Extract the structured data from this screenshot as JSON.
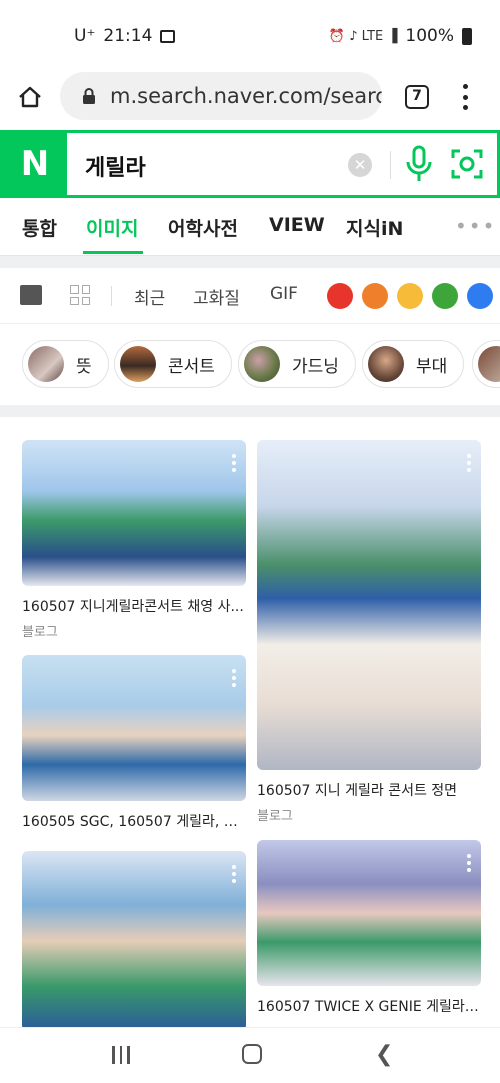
{
  "status_bar": {
    "carrier": "U⁺",
    "time": "21:14",
    "indicators": "⏰ ♪ LTE ▐",
    "battery": "100%"
  },
  "browser": {
    "url": "m.search.naver.com/search",
    "tab_count": "7"
  },
  "search": {
    "logo": "N",
    "query": "게릴라",
    "clear_icon": "✕"
  },
  "nav_tabs": [
    {
      "label": "통합"
    },
    {
      "label": "이미지"
    },
    {
      "label": "어학사전"
    },
    {
      "label": "VIEW"
    },
    {
      "label": "지식iN"
    }
  ],
  "nav_more": "•••",
  "filters": {
    "options": [
      "최근",
      "고화질",
      "GIF"
    ],
    "colors": [
      "#e8352b",
      "#f07f2c",
      "#f7bb3a",
      "#3da53a",
      "#2f7cf0"
    ]
  },
  "chips": [
    {
      "label": "뜻"
    },
    {
      "label": "콘서트"
    },
    {
      "label": "가드닝"
    },
    {
      "label": "부대"
    }
  ],
  "results": [
    {
      "title": "160507 지니게릴라콘서트 채영 사...",
      "source": "블로그"
    },
    {
      "title": "160507 지니 게릴라 콘서트 정면",
      "source": "블로그"
    },
    {
      "title": "160505 SGC, 160507 게릴라, 15...",
      "source": ""
    },
    {
      "title": "",
      "source": ""
    },
    {
      "title": "160507 TWICE X GENIE 게릴라 ...",
      "source": ""
    }
  ]
}
